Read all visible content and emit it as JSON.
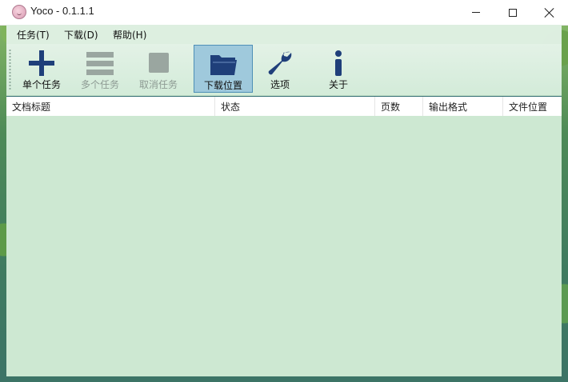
{
  "window": {
    "title": "Yoco - 0.1.1.1"
  },
  "menu": [
    {
      "label": "任务(T)"
    },
    {
      "label": "下载(D)"
    },
    {
      "label": "帮助(H)"
    }
  ],
  "toolbar": [
    {
      "label": "单个任务",
      "icon": "plus-icon",
      "state": "enabled"
    },
    {
      "label": "多个任务",
      "icon": "list-icon",
      "state": "disabled"
    },
    {
      "label": "取消任务",
      "icon": "stop-icon",
      "state": "disabled"
    },
    {
      "label": "下载位置",
      "icon": "folder-icon",
      "state": "active"
    },
    {
      "label": "选项",
      "icon": "wrench-icon",
      "state": "enabled"
    },
    {
      "label": "关于",
      "icon": "info-icon",
      "state": "enabled"
    }
  ],
  "table": {
    "columns": [
      "文档标题",
      "状态",
      "页数",
      "输出格式",
      "文件位置"
    ],
    "rows": []
  },
  "colors": {
    "accent": "#1f3f7a",
    "client_bg": "#cde8d2",
    "active_tool_bg": "#9fc9dc"
  }
}
